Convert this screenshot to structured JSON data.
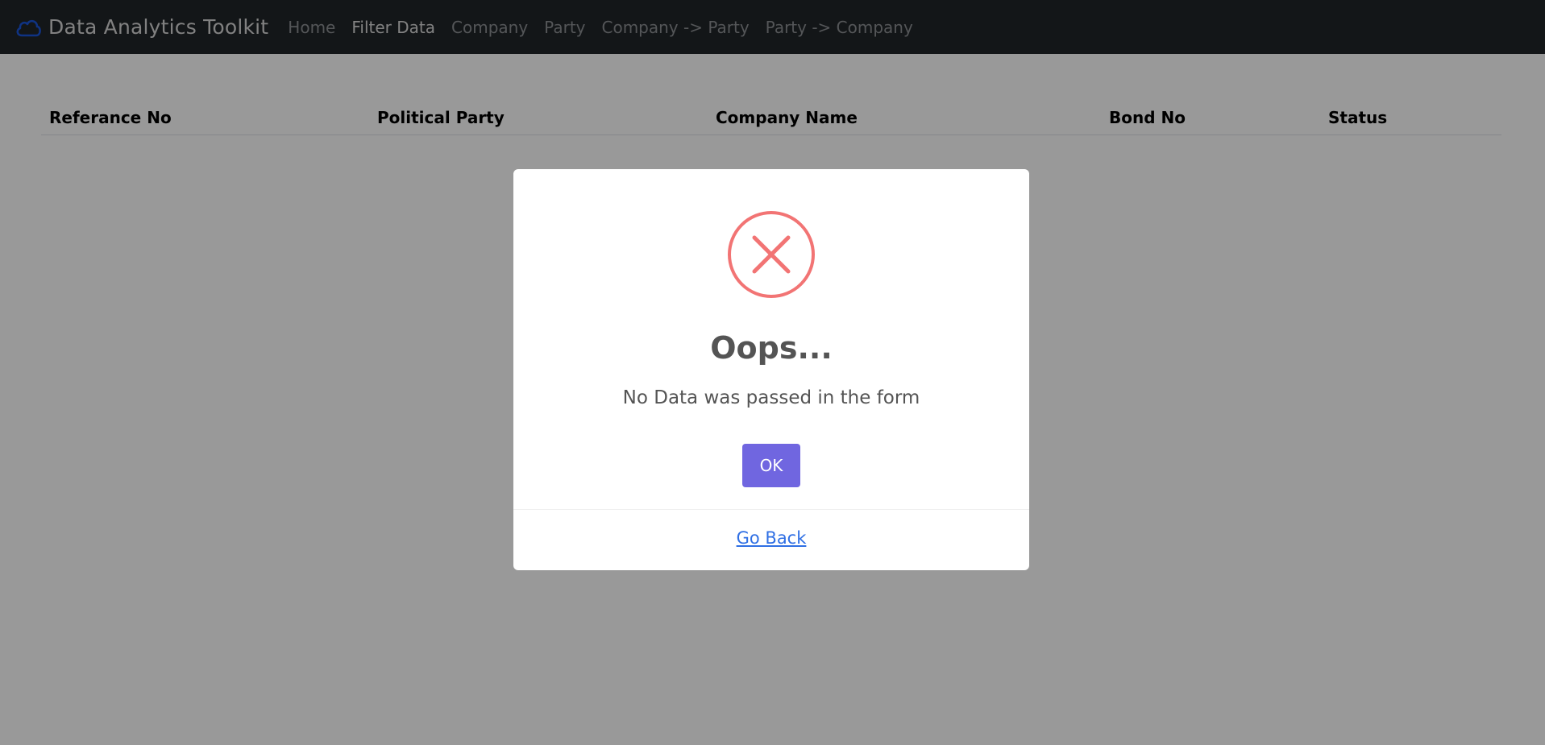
{
  "navbar": {
    "brand_icon": "cloud-icon",
    "brand": "Data Analytics Toolkit",
    "links": [
      {
        "label": "Home",
        "active": false
      },
      {
        "label": "Filter Data",
        "active": true
      },
      {
        "label": "Company",
        "active": false
      },
      {
        "label": "Party",
        "active": false
      },
      {
        "label": "Company -> Party",
        "active": false
      },
      {
        "label": "Party -> Company",
        "active": false
      }
    ]
  },
  "table": {
    "columns": [
      "Referance No",
      "Political Party",
      "Company Name",
      "Bond No",
      "Status"
    ]
  },
  "modal": {
    "icon": "error-x-icon",
    "title": "Oops...",
    "text": "No Data was passed in the form",
    "ok_label": "OK",
    "footer_link": "Go Back"
  },
  "colors": {
    "navbar_bg": "#212529",
    "ok_button": "#7066e0",
    "error_icon": "#f27474",
    "link": "#2f6fe4",
    "brand_icon": "#1a56db"
  }
}
